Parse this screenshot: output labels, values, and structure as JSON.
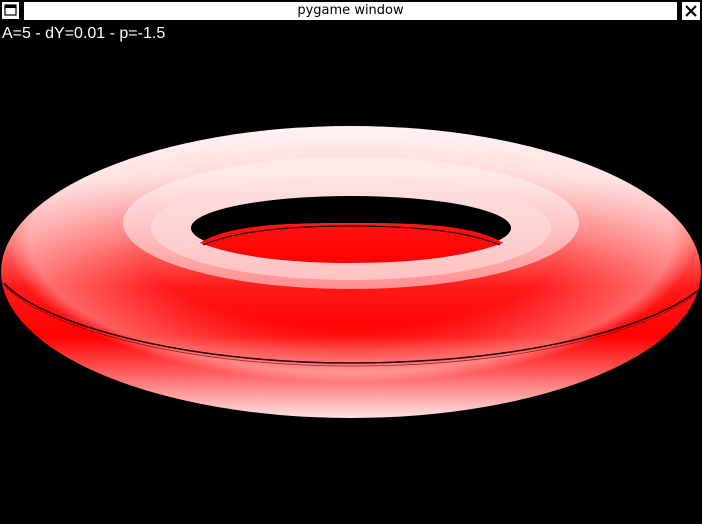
{
  "window": {
    "title": "pygame window",
    "menu_icon": "window-menu-icon",
    "close_icon": "close-icon"
  },
  "canvas": {
    "params_text": "A=5 - dY=0.01 - p=-1.5",
    "shape": "torus",
    "colors": {
      "background": "#000000",
      "highlight": "#fff0f0",
      "base": "#ff0000",
      "shadow": "#e00000"
    }
  }
}
